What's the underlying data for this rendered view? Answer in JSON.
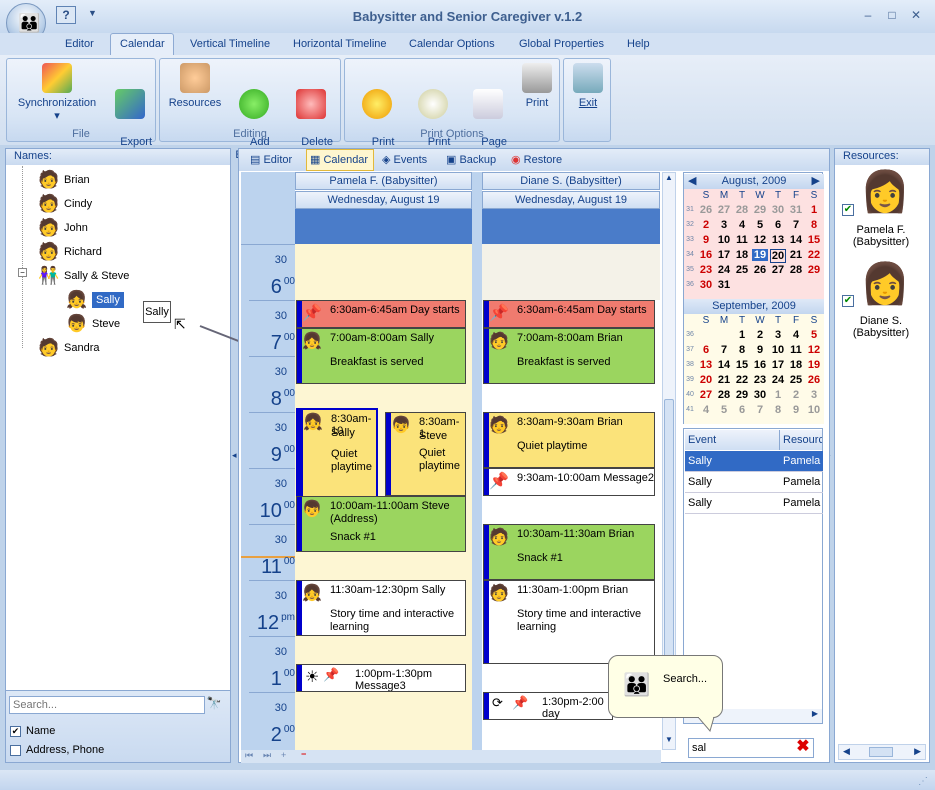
{
  "app": {
    "title": "Babysitter and Senior Caregiver v.1.2",
    "help_label": "?"
  },
  "menu": [
    "Editor",
    "Calendar",
    "Vertical Timeline",
    "Horizontal Timeline",
    "Calendar Options",
    "Global Properties",
    "Help"
  ],
  "ribbon": {
    "groups": {
      "file": "File",
      "editing": "Editing",
      "print_options": "Print Options"
    },
    "buttons": {
      "sync": "Synchronization",
      "export": "Export\nTo...",
      "resources": "Resources",
      "add_event": "Add\nEvent...",
      "delete_event": "Delete\nEvent",
      "print_designer": "Print\nDesigner",
      "print_preview": "Print\nPreview",
      "page_setup": "Page\nSetup...",
      "print": "Print",
      "exit": "Exit"
    }
  },
  "names_panel": {
    "title": "Names:",
    "people": [
      "Brian",
      "Cindy",
      "John",
      "Richard",
      "Sally & Steve",
      "Sally",
      "Steve",
      "Sandra"
    ],
    "drag_tip": "Sally",
    "search_placeholder": "Search...",
    "filter_name": "Name",
    "filter_address": "Address, Phone"
  },
  "center_tabs": [
    "Editor",
    "Calendar",
    "Events",
    "Backup",
    "Restore"
  ],
  "timeline": {
    "hours": [
      {
        "h": "6",
        "s": "00"
      },
      {
        "h": "7",
        "s": "00"
      },
      {
        "h": "8",
        "s": "00"
      },
      {
        "h": "9",
        "s": "00"
      },
      {
        "h": "10",
        "s": "00"
      },
      {
        "h": "11",
        "s": "00"
      },
      {
        "h": "12",
        "s": "pm"
      },
      {
        "h": "1",
        "s": "00"
      },
      {
        "h": "2",
        "s": "00"
      }
    ],
    "half": "30"
  },
  "columns": [
    {
      "resource": "Pamela F. (Babysitter)",
      "date": "Wednesday, August 19"
    },
    {
      "resource": "Diane S. (Babysitter)",
      "date": "Wednesday, August 19"
    }
  ],
  "events_col1": [
    {
      "time": "6:30am-6:45am Day starts",
      "desc": ""
    },
    {
      "time": "7:00am-8:00am Sally",
      "desc": "Breakfast is served"
    },
    {
      "time": "8:30am-10",
      "sub": "Sally",
      "desc": "Quiet playtime"
    },
    {
      "time": "8:30am-1",
      "sub": "Steve",
      "desc": "Quiet playtime"
    },
    {
      "time": "10:00am-11:00am Steve",
      "sub": "(Address)",
      "desc": "Snack #1"
    },
    {
      "time": "11:30am-12:30pm Sally",
      "desc": "Story time and interactive learning"
    },
    {
      "time": "1:00pm-1:30pm",
      "desc": "Message3"
    }
  ],
  "events_col2": [
    {
      "time": "6:30am-6:45am Day starts",
      "desc": ""
    },
    {
      "time": "7:00am-8:00am Brian",
      "desc": "Breakfast is served"
    },
    {
      "time": "8:30am-9:30am Brian",
      "desc": "Quiet playtime"
    },
    {
      "time": "9:30am-10:00am Message2",
      "desc": ""
    },
    {
      "time": "10:30am-11:30am Brian",
      "desc": "Snack #1"
    },
    {
      "time": "11:30am-1:00pm Brian",
      "desc": "Story time and interactive learning"
    },
    {
      "time": "1:30pm-2:00",
      "desc": "day"
    }
  ],
  "mini_calendars": {
    "weekdays": [
      "S",
      "M",
      "T",
      "W",
      "T",
      "F",
      "S"
    ],
    "aug": {
      "title": "August, 2009",
      "weeks": [
        "31",
        "32",
        "33",
        "34",
        "35",
        "36"
      ],
      "days": [
        [
          "26",
          "27",
          "28",
          "29",
          "30",
          "31",
          "1"
        ],
        [
          "2",
          "3",
          "4",
          "5",
          "6",
          "7",
          "8"
        ],
        [
          "9",
          "10",
          "11",
          "12",
          "13",
          "14",
          "15"
        ],
        [
          "16",
          "17",
          "18",
          "19",
          "20",
          "21",
          "22"
        ],
        [
          "23",
          "24",
          "25",
          "26",
          "27",
          "28",
          "29"
        ],
        [
          "30",
          "31",
          "",
          "",
          "",
          "",
          ""
        ]
      ]
    },
    "sep": {
      "title": "September, 2009",
      "weeks": [
        "36",
        "37",
        "38",
        "39",
        "40",
        "41"
      ],
      "days": [
        [
          "",
          "",
          "1",
          "2",
          "3",
          "4",
          "5"
        ],
        [
          "6",
          "7",
          "8",
          "9",
          "10",
          "11",
          "12"
        ],
        [
          "13",
          "14",
          "15",
          "16",
          "17",
          "18",
          "19"
        ],
        [
          "20",
          "21",
          "22",
          "23",
          "24",
          "25",
          "26"
        ],
        [
          "27",
          "28",
          "29",
          "30",
          "1",
          "2",
          "3"
        ],
        [
          "4",
          "5",
          "6",
          "7",
          "8",
          "9",
          "10"
        ]
      ]
    }
  },
  "event_table": {
    "headers": [
      "Event",
      "Resource"
    ],
    "rows": [
      {
        "event": "Sally",
        "res": "Pamela F"
      },
      {
        "event": "Sally",
        "res": "Pamela F"
      },
      {
        "event": "Sally",
        "res": "Pamela F"
      }
    ]
  },
  "search_balloon": "Search...",
  "filter_value": "sal",
  "resources_panel": {
    "title": "Resources:",
    "items": [
      {
        "name": "Pamela F.\n(Babysitter)"
      },
      {
        "name": "Diane S.\n(Babysitter)"
      }
    ]
  },
  "colors": {
    "accent": "#15428b",
    "event_red": "#f07b6f",
    "event_green": "#9bd55f",
    "event_yellow": "#fbe37a",
    "today": "#316ac5"
  }
}
